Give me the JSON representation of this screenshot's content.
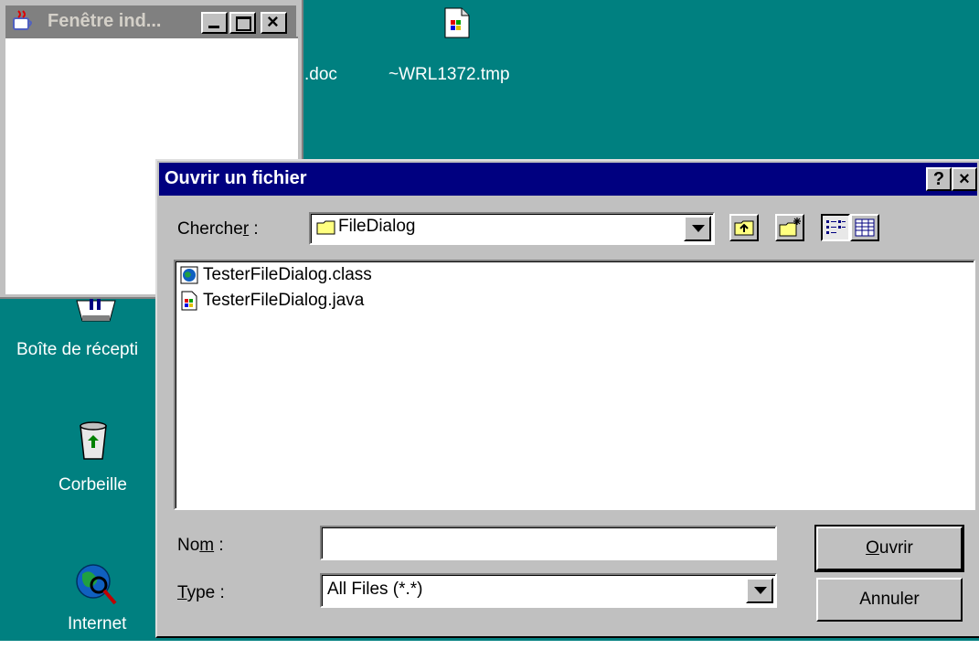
{
  "desktop": {
    "background": "#008080",
    "labels": {
      "doc_file": ".doc",
      "tmp_file": "~WRL1372.tmp",
      "inbox": "Boîte de récepti",
      "recycle": "Corbeille",
      "internet": "Internet"
    }
  },
  "java_window": {
    "title": "Fenêtre ind...",
    "icon": "java-cup-icon"
  },
  "dialog": {
    "title": "Ouvrir un fichier",
    "help_label": "?",
    "close_label": "×",
    "look_in_label_pre": "Cherche",
    "look_in_label_u": "r",
    "look_in_label_post": " :",
    "look_in_value": "FileDialog",
    "files": [
      {
        "name": "TesterFileDialog.class",
        "icon": "class-file-icon"
      },
      {
        "name": "TesterFileDialog.java",
        "icon": "java-file-icon"
      }
    ],
    "name_label_pre": "No",
    "name_label_u": "m",
    "name_label_post": " :",
    "name_value": "",
    "type_label_u": "T",
    "type_label_post": "ype :",
    "type_value": "All Files (*.*)",
    "open_label_u": "O",
    "open_label_post": "uvrir",
    "cancel_label": "Annuler"
  }
}
